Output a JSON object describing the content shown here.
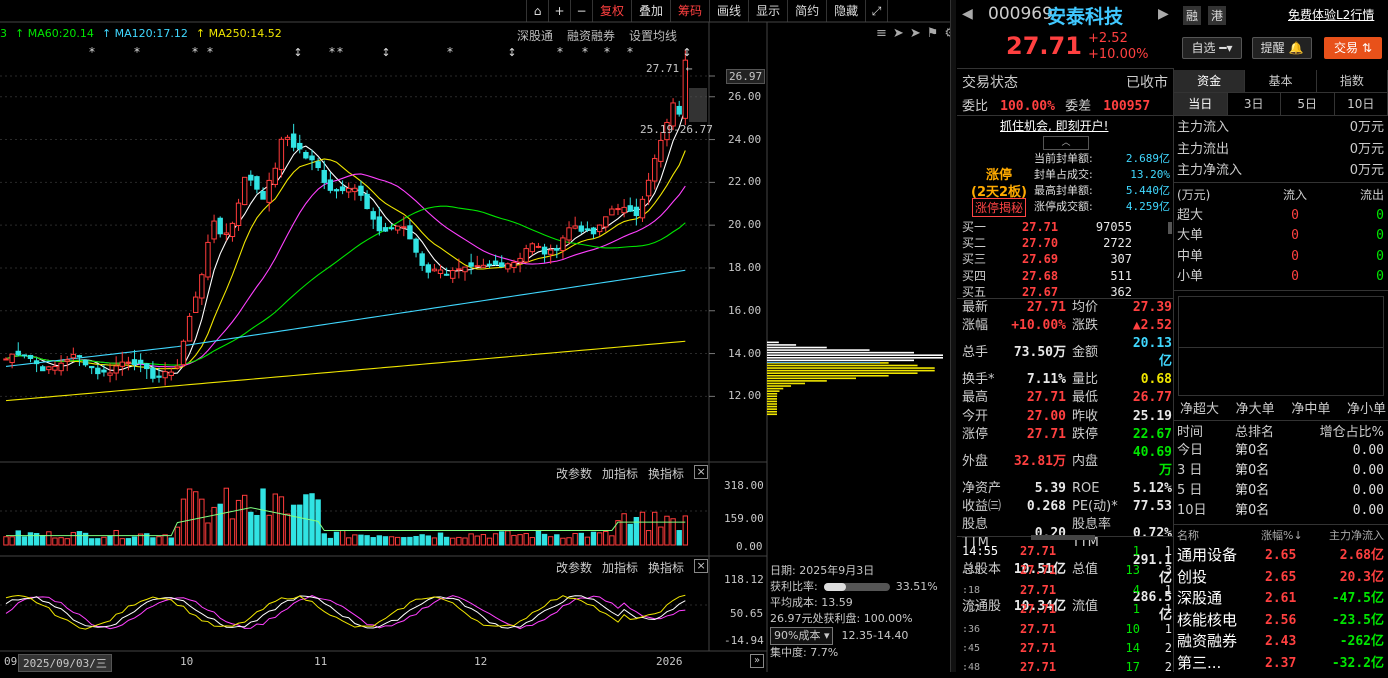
{
  "toolbar": {
    "items": [
      "复权",
      "叠加",
      "筹码",
      "画线",
      "显示",
      "简约",
      "隐藏"
    ]
  },
  "ma": {
    "items": [
      {
        "label": "MA60:20.14",
        "color": "#00e600"
      },
      {
        "label": "MA120:17.12",
        "color": "#40d8ff"
      },
      {
        "label": "MA250:14.52",
        "color": "#f0e600"
      }
    ],
    "left_num": "3"
  },
  "chart_tools": {
    "a": "深股通",
    "b": "融资融券",
    "c": "设置均线"
  },
  "price_axis": [
    "26.97",
    "26.00",
    "24.00",
    "22.00",
    "20.00",
    "18.00",
    "16.00",
    "14.00",
    "12.00"
  ],
  "price_callouts": {
    "high": "27.71",
    "range": "25.19-26.77"
  },
  "vol_panel": {
    "btn1": "改参数",
    "btn2": "加指标",
    "btn3": "换指标",
    "axis": [
      "318.00",
      "159.00",
      "0.00"
    ]
  },
  "ind_panel": {
    "btn1": "改参数",
    "btn2": "加指标",
    "btn3": "换指标",
    "axis": [
      "118.12",
      "50.65",
      "-14.94"
    ]
  },
  "x_axis": {
    "date": "2025/09/03/三",
    "labels": [
      "09",
      "10",
      "11",
      "12",
      "2026"
    ]
  },
  "chip": {
    "date_label": "日期: 2025年9月3日",
    "profit_label": "获利比率:",
    "profit_val": "33.51%",
    "profit_ratio": 0.3351,
    "avg_label": "平均成本: 13.59",
    "line1": "26.97元处获利盘: 100.00%",
    "select": "90%成本",
    "range": "12.35-14.40",
    "conc": "集中度: 7.7%"
  },
  "stock": {
    "code": "000969",
    "name": "安泰科技",
    "price": "27.71",
    "change": "+2.52",
    "pct": "+10.00%",
    "b1": "融",
    "b2": "港",
    "l2": "免费体验L2行情",
    "zixuan": "自选",
    "tixing": "提醒",
    "jiaoyi": "交易"
  },
  "status": {
    "label": "交易状态",
    "value": "已收市",
    "wb_label": "委比",
    "wb": "100.00%",
    "wc_label": "委差",
    "wc": "100957"
  },
  "promo": "抓住机会, 即刻开户!",
  "limit": {
    "title": "涨停",
    "sub": "(2天2板)",
    "reveal": "涨停揭秘",
    "rows": [
      {
        "k": "当前封单额:",
        "v": "2.689亿"
      },
      {
        "k": "封单占成交:",
        "v": "13.20%"
      },
      {
        "k": "最高封单额:",
        "v": "5.440亿"
      },
      {
        "k": "涨停成交额:",
        "v": "4.259亿"
      }
    ]
  },
  "bids": [
    {
      "l": "买一",
      "p": "27.71",
      "v": "97055"
    },
    {
      "l": "买二",
      "p": "27.70",
      "v": "2722"
    },
    {
      "l": "买三",
      "p": "27.69",
      "v": "307"
    },
    {
      "l": "买四",
      "p": "27.68",
      "v": "511"
    },
    {
      "l": "买五",
      "p": "27.67",
      "v": "362"
    }
  ],
  "quote": [
    {
      "k1": "最新",
      "v1": "27.71",
      "c1": "red",
      "k2": "均价",
      "v2": "27.39",
      "c2": "red"
    },
    {
      "k1": "涨幅",
      "v1": "+10.00%",
      "c1": "red",
      "k2": "涨跌",
      "v2": "▲2.52",
      "c2": "red"
    },
    {
      "k1": "总手",
      "v1": "73.50万",
      "c1": "wht",
      "k2": "金额",
      "v2": "20.13亿",
      "c2": "cyn"
    },
    {
      "k1": "换手*",
      "v1": "7.11%",
      "c1": "wht",
      "k2": "量比",
      "v2": "0.68",
      "c2": "ylw"
    },
    {
      "k1": "最高",
      "v1": "27.71",
      "c1": "red",
      "k2": "最低",
      "v2": "26.77",
      "c2": "red"
    },
    {
      "k1": "今开",
      "v1": "27.00",
      "c1": "red",
      "k2": "昨收",
      "v2": "25.19",
      "c2": "wht"
    },
    {
      "k1": "涨停",
      "v1": "27.71",
      "c1": "red",
      "k2": "跌停",
      "v2": "22.67",
      "c2": "grn"
    },
    {
      "k1": "外盘",
      "v1": "32.81万",
      "c1": "red",
      "k2": "内盘",
      "v2": "40.69万",
      "c2": "grn"
    },
    {
      "k1": "净资产",
      "v1": "5.39",
      "c1": "wht",
      "k2": "ROE",
      "v2": "5.12%",
      "c2": "wht"
    },
    {
      "k1": "收益㈢",
      "v1": "0.268",
      "c1": "wht",
      "k2": "PE(动)*",
      "v2": "77.53",
      "c2": "wht"
    },
    {
      "k1": "股息TTM",
      "v1": "0.20",
      "c1": "wht",
      "k2": "股息率TTM",
      "v2": "0.72%",
      "c2": "wht"
    },
    {
      "k1": "总股本",
      "v1": "10.51亿",
      "c1": "wht",
      "k2": "总值",
      "v2": "291.1亿",
      "c2": "wht"
    },
    {
      "k1": "流通股",
      "v1": "10.34亿",
      "c1": "wht",
      "k2": "流值",
      "v2": "286.5亿",
      "c2": "wht"
    }
  ],
  "ticks": [
    {
      "t": "14:55",
      "p": "27.71",
      "v": "1",
      "n": "1"
    },
    {
      "t": ":15",
      "p": "27.71",
      "v": "13",
      "n": "3"
    },
    {
      "t": ":18",
      "p": "27.71",
      "v": "4",
      "n": "1"
    },
    {
      "t": ":27",
      "p": "27.71",
      "v": "1",
      "n": "1"
    },
    {
      "t": ":36",
      "p": "27.71",
      "v": "10",
      "n": "1"
    },
    {
      "t": ":45",
      "p": "27.71",
      "v": "14",
      "n": "2"
    },
    {
      "t": ":48",
      "p": "27.71",
      "v": "17",
      "n": "2"
    }
  ],
  "fund": {
    "tabs": [
      "资金",
      "基本",
      "指数"
    ],
    "periods": [
      "当日",
      "3日",
      "5日",
      "10日"
    ],
    "flow": [
      {
        "k": "主力流入",
        "v": "0万元"
      },
      {
        "k": "主力流出",
        "v": "0万元"
      },
      {
        "k": "主力净流入",
        "v": "0万元"
      }
    ],
    "head": {
      "unit": "(万元)",
      "in": "流入",
      "out": "流出"
    },
    "sizes": [
      {
        "k": "超大",
        "in": "0",
        "out": "0"
      },
      {
        "k": "大单",
        "in": "0",
        "out": "0"
      },
      {
        "k": "中单",
        "in": "0",
        "out": "0"
      },
      {
        "k": "小单",
        "in": "0",
        "out": "0"
      }
    ],
    "net_labels": [
      "净超大",
      "净大单",
      "净中单",
      "净小单"
    ],
    "rank_head": {
      "a": "时间",
      "b": "总排名",
      "c": "增仓占比%"
    },
    "rank": [
      {
        "t": "今日",
        "r": "第0名",
        "v": "0.00"
      },
      {
        "t": "3 日",
        "r": "第0名",
        "v": "0.00"
      },
      {
        "t": "5 日",
        "r": "第0名",
        "v": "0.00"
      },
      {
        "t": "10日",
        "r": "第0名",
        "v": "0.00"
      }
    ]
  },
  "sectors": {
    "head": {
      "a": "名称",
      "b": "涨幅%",
      "c": "主力净流入"
    },
    "rows": [
      {
        "n": "通用设备",
        "p": "2.65",
        "f": "2.68亿",
        "fc": "red"
      },
      {
        "n": "创投",
        "p": "2.65",
        "f": "20.3亿",
        "fc": "red"
      },
      {
        "n": "深股通",
        "p": "2.61",
        "f": "-47.5亿",
        "fc": "grn"
      },
      {
        "n": "核能核电",
        "p": "2.56",
        "f": "-23.5亿",
        "fc": "grn"
      },
      {
        "n": "融资融券",
        "p": "2.43",
        "f": "-262亿",
        "fc": "grn"
      },
      {
        "n": "第三...",
        "p": "2.37",
        "f": "-32.2亿",
        "fc": "grn"
      }
    ]
  },
  "chart_data": {
    "type": "candlestick",
    "title": "",
    "ylim": [
      11,
      28
    ],
    "ma_lines": [
      "MA60",
      "MA120",
      "MA250"
    ],
    "last_close": 27.71
  }
}
